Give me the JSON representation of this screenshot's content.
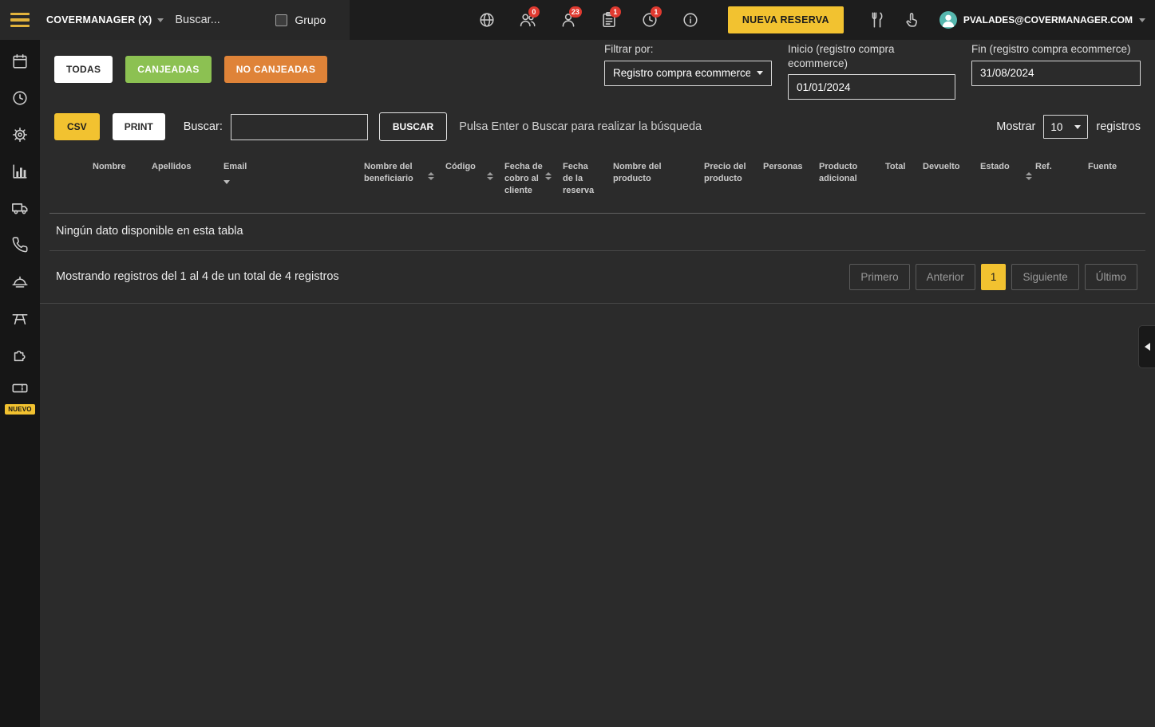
{
  "topbar": {
    "brand": "COVERMANAGER (X)",
    "search_placeholder": "Buscar...",
    "group_label": "Grupo",
    "icons": [
      {
        "name": "globe-icon",
        "badge": ""
      },
      {
        "name": "users-icon",
        "badge": "0"
      },
      {
        "name": "user-icon",
        "badge": "23"
      },
      {
        "name": "clipboard-icon",
        "badge": "1"
      },
      {
        "name": "clock-icon",
        "badge": "1"
      },
      {
        "name": "info-icon",
        "badge": ""
      }
    ],
    "new_reservation_label": "NUEVA RESERVA",
    "extra_icons": [
      {
        "name": "cutlery-icon"
      },
      {
        "name": "hand-pointer-icon"
      }
    ],
    "account_email": "PVALADES@COVERMANAGER.COM"
  },
  "sidebar": {
    "items": [
      {
        "icon": "calendar-icon"
      },
      {
        "icon": "clock-icon"
      },
      {
        "icon": "gear-icon"
      },
      {
        "icon": "bar-chart-icon"
      },
      {
        "icon": "truck-icon"
      },
      {
        "icon": "phone-icon"
      },
      {
        "icon": "bell-icon"
      },
      {
        "icon": "table-icon"
      },
      {
        "icon": "puzzle-icon"
      },
      {
        "icon": "ticket-icon",
        "badge": "NUEVO"
      }
    ]
  },
  "filters": {
    "tabs": [
      {
        "label": "TODAS"
      },
      {
        "label": "CANJEADAS"
      },
      {
        "label": "NO CANJEADAS"
      }
    ],
    "filter_by_label": "Filtrar por:",
    "filter_by_value": "Registro compra ecommerce",
    "start_label": "Inicio (registro compra ecommerce)",
    "start_value": "01/01/2024",
    "end_label": "Fin (registro compra ecommerce)",
    "end_value": "31/08/2024"
  },
  "toolbar": {
    "csv_label": "CSV",
    "print_label": "PRINT",
    "search_label": "Buscar:",
    "search_button_label": "BUSCAR",
    "search_hint": "Pulsa Enter o Buscar para realizar la búsqueda",
    "show_label": "Mostrar",
    "show_value": "10",
    "records_label": "registros"
  },
  "table": {
    "columns": [
      {
        "label": "Nombre",
        "sort": "none"
      },
      {
        "label": "Apellidos",
        "sort": "none"
      },
      {
        "label": "Email",
        "sort": "desc"
      },
      {
        "label": "Nombre del beneficiario",
        "sort": "both"
      },
      {
        "label": "Código",
        "sort": "both"
      },
      {
        "label": "Fecha de cobro al cliente",
        "sort": "both"
      },
      {
        "label": "Fecha de la reserva",
        "sort": "none"
      },
      {
        "label": "Nombre del producto",
        "sort": "none"
      },
      {
        "label": "Precio del producto",
        "sort": "none"
      },
      {
        "label": "Personas",
        "sort": "none"
      },
      {
        "label": "Producto adicional",
        "sort": "none"
      },
      {
        "label": "Total",
        "sort": "none"
      },
      {
        "label": "Devuelto",
        "sort": "none"
      },
      {
        "label": "Estado",
        "sort": "none"
      },
      {
        "label": "Ref.",
        "sort": "both"
      },
      {
        "label": "Fuente",
        "sort": "none"
      }
    ],
    "rows": [],
    "empty_message": "Ningún dato disponible en esta tabla",
    "summary": "Mostrando registros del 1 al 4 de un total de 4 registros"
  },
  "pagination": {
    "first": "Primero",
    "previous": "Anterior",
    "current_page": "1",
    "next": "Siguiente",
    "last": "Último"
  },
  "colors": {
    "accent_yellow": "#f2c230",
    "green": "#8cc152",
    "orange": "#df8338",
    "badge_red": "#e03a30",
    "background_dark": "#2b2b2b",
    "topbar_dark": "#1d1d1d"
  }
}
